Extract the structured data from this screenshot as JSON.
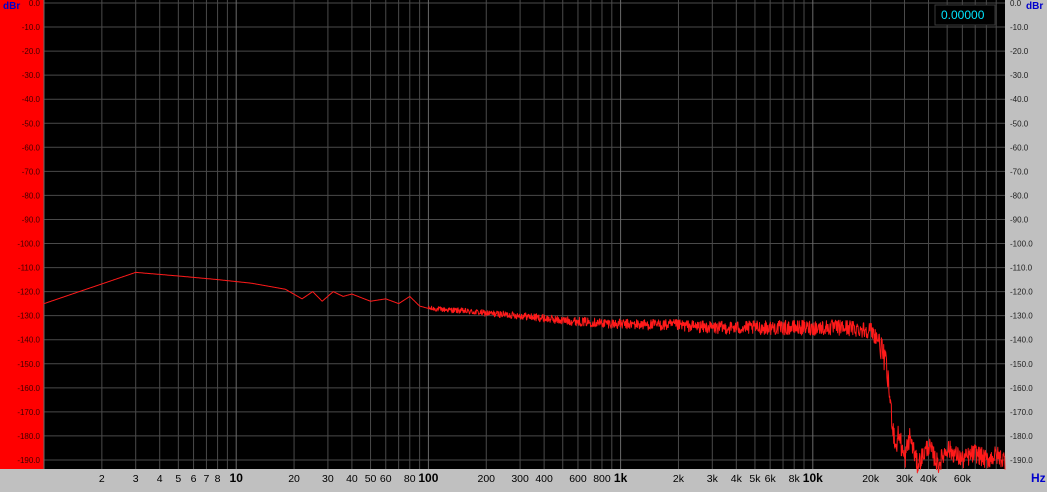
{
  "colors": {
    "plot_bg": "#000000",
    "grid": "#4a4a4a",
    "grid_major": "#6a6a6a",
    "trace": "#ff1a1a",
    "left_panel": "#ff0000",
    "right_panel": "#c0c0c0",
    "bottom_panel": "#c0c0c0",
    "unit_label": "#0000cc",
    "readout": "#00e5ff"
  },
  "readout": {
    "value": "0.00000"
  },
  "chart_data": {
    "type": "line",
    "title": "",
    "xlabel": "",
    "ylabel": "",
    "x_unit_label": "Hz",
    "y_unit_label": "dBr",
    "x_scale": "log",
    "xlim": [
      1,
      100000
    ],
    "ylim": [
      -195,
      0
    ],
    "grid": true,
    "y_ticks": [
      {
        "v": 0,
        "label": "0.0"
      },
      {
        "v": -10,
        "label": "-10.0"
      },
      {
        "v": -20,
        "label": "-20.0"
      },
      {
        "v": -30,
        "label": "-30.0"
      },
      {
        "v": -40,
        "label": "-40.0"
      },
      {
        "v": -50,
        "label": "-50.0"
      },
      {
        "v": -60,
        "label": "-60.0"
      },
      {
        "v": -70,
        "label": "-70.0"
      },
      {
        "v": -80,
        "label": "-80.0"
      },
      {
        "v": -90,
        "label": "-90.0"
      },
      {
        "v": -100,
        "label": "-100.0"
      },
      {
        "v": -110,
        "label": "-110.0"
      },
      {
        "v": -120,
        "label": "-120.0"
      },
      {
        "v": -130,
        "label": "-130.0"
      },
      {
        "v": -140,
        "label": "-140.0"
      },
      {
        "v": -150,
        "label": "-150.0"
      },
      {
        "v": -160,
        "label": "-160.0"
      },
      {
        "v": -170,
        "label": "-170.0"
      },
      {
        "v": -180,
        "label": "-180.0"
      },
      {
        "v": -190,
        "label": "-190.0"
      }
    ],
    "x_ticks": [
      {
        "v": 2,
        "label": "2",
        "bold": false
      },
      {
        "v": 3,
        "label": "3",
        "bold": false
      },
      {
        "v": 4,
        "label": "4",
        "bold": false
      },
      {
        "v": 5,
        "label": "5",
        "bold": false
      },
      {
        "v": 6,
        "label": "6",
        "bold": false
      },
      {
        "v": 7,
        "label": "7",
        "bold": false
      },
      {
        "v": 8,
        "label": "8",
        "bold": false
      },
      {
        "v": 10,
        "label": "10",
        "bold": true
      },
      {
        "v": 20,
        "label": "20",
        "bold": false
      },
      {
        "v": 30,
        "label": "30",
        "bold": false
      },
      {
        "v": 40,
        "label": "40",
        "bold": false
      },
      {
        "v": 50,
        "label": "50",
        "bold": false
      },
      {
        "v": 60,
        "label": "60",
        "bold": false
      },
      {
        "v": 80,
        "label": "80",
        "bold": false
      },
      {
        "v": 100,
        "label": "100",
        "bold": true
      },
      {
        "v": 200,
        "label": "200",
        "bold": false
      },
      {
        "v": 300,
        "label": "300",
        "bold": false
      },
      {
        "v": 400,
        "label": "400",
        "bold": false
      },
      {
        "v": 600,
        "label": "600",
        "bold": false
      },
      {
        "v": 800,
        "label": "800",
        "bold": false
      },
      {
        "v": 1000,
        "label": "1k",
        "bold": true
      },
      {
        "v": 2000,
        "label": "2k",
        "bold": false
      },
      {
        "v": 3000,
        "label": "3k",
        "bold": false
      },
      {
        "v": 4000,
        "label": "4k",
        "bold": false
      },
      {
        "v": 5000,
        "label": "5k",
        "bold": false
      },
      {
        "v": 6000,
        "label": "6k",
        "bold": false
      },
      {
        "v": 8000,
        "label": "8k",
        "bold": false
      },
      {
        "v": 10000,
        "label": "10k",
        "bold": true
      },
      {
        "v": 20000,
        "label": "20k",
        "bold": false
      },
      {
        "v": 30000,
        "label": "30k",
        "bold": false
      },
      {
        "v": 40000,
        "label": "40k",
        "bold": false
      },
      {
        "v": 60000,
        "label": "60k",
        "bold": false
      }
    ],
    "series": [
      {
        "color": "#ff1a1a",
        "x": [
          1,
          3,
          5,
          8,
          12,
          18,
          22,
          25,
          28,
          32,
          36,
          40,
          50,
          60,
          70,
          80,
          90,
          100,
          150,
          200,
          300,
          500,
          800,
          1000,
          2000,
          3000,
          5000,
          8000,
          10000,
          15000,
          20000,
          22000,
          24000,
          25000,
          26000,
          27000,
          28000,
          30000,
          32000,
          35000,
          40000,
          45000,
          50000,
          60000,
          70000,
          80000,
          90000,
          100000
        ],
        "y": [
          -125,
          -112,
          -113.5,
          -115,
          -116.5,
          -119,
          -123,
          -120,
          -124,
          -120,
          -122,
          -121,
          -124,
          -123,
          -125,
          -122,
          -126,
          -127,
          -128,
          -129,
          -130,
          -132,
          -133,
          -133.5,
          -134,
          -135,
          -135,
          -135,
          -135,
          -135,
          -136,
          -140,
          -150,
          -162,
          -175,
          -185,
          -179,
          -190,
          -180,
          -192,
          -184,
          -192,
          -185,
          -190,
          -187,
          -190,
          -188,
          -190
        ]
      }
    ]
  }
}
